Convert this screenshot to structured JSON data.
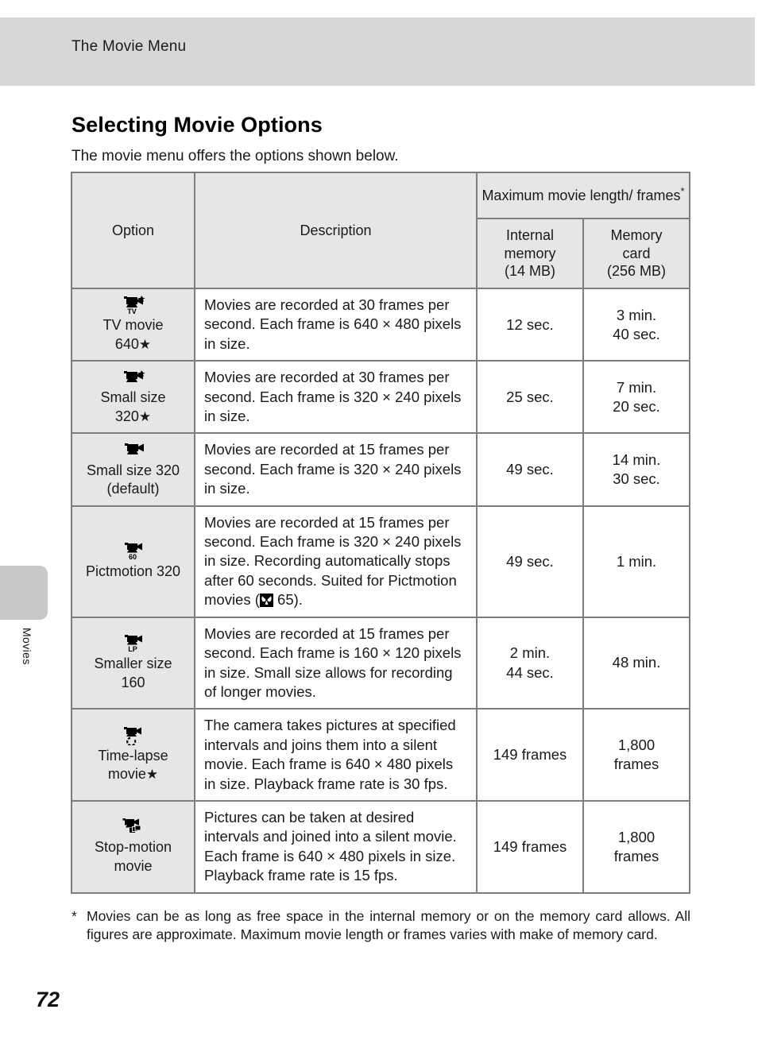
{
  "running_header": {
    "text": "The Movie Menu"
  },
  "side_tab": {
    "label": "Movies"
  },
  "page": {
    "title": "Selecting Movie Options",
    "intro": "The movie menu offers the options shown below.",
    "number": "72"
  },
  "table": {
    "headers": {
      "option": "Option",
      "description": "Description",
      "maximum_group": "Maximum movie length/ frames",
      "maximum_group_mark": "*",
      "internal": "Internal memory (14 MB)",
      "internal_line1": "Internal",
      "internal_line2": "memory",
      "internal_line3": "(14 MB)",
      "card_line1": "Memory",
      "card_line2": "card",
      "card_line3": "(256 MB)"
    },
    "rows": [
      {
        "icon": "movie-camera-tv-icon",
        "icon_badge": "TV",
        "icon_star": true,
        "option_line1": "TV movie",
        "option_line2": "640",
        "option_star": "★",
        "description": "Movies are recorded at 30 frames per second. Each frame is 640 × 480 pixels in size.",
        "internal": "12 sec.",
        "card_line1": "3 min.",
        "card_line2": "40 sec."
      },
      {
        "icon": "movie-camera-star-icon",
        "icon_badge": "",
        "icon_star": true,
        "option_line1": "Small size",
        "option_line2": "320",
        "option_star": "★",
        "description": "Movies are recorded at 30 frames per second. Each frame is 320 × 240 pixels in size.",
        "internal": "25 sec.",
        "card_line1": "7 min.",
        "card_line2": "20 sec."
      },
      {
        "icon": "movie-camera-icon",
        "icon_badge": "",
        "icon_star": false,
        "option_line1": "Small size 320",
        "option_line2": "(default)",
        "option_star": "",
        "description": "Movies are recorded at 15 frames per second. Each frame is 320 × 240 pixels in size.",
        "internal": "49 sec.",
        "card_line1": "14 min.",
        "card_line2": "30 sec."
      },
      {
        "icon": "movie-camera-60-icon",
        "icon_badge": "60",
        "icon_star": false,
        "option_line1": "Pictmotion 320",
        "option_line2": "",
        "option_star": "",
        "description_pre": "Movies are recorded at 15 frames per second. Each frame is 320 × 240 pixels in size. Recording automatically stops after 60 seconds. Suited for Pictmotion movies (",
        "description_ref_icon": "reference-butterfly-icon",
        "description_post": " 65).",
        "internal": "49 sec.",
        "card_line1": "1 min.",
        "card_line2": ""
      },
      {
        "icon": "movie-camera-lp-icon",
        "icon_badge": "LP",
        "icon_star": false,
        "option_line1": "Smaller size",
        "option_line2": "160",
        "option_star": "",
        "description": "Movies are recorded at 15 frames per second. Each frame is 160 × 120 pixels in size. Small size allows for recording of longer movies.",
        "internal_line1": "2 min.",
        "internal_line2": "44 sec.",
        "card_line1": "48 min.",
        "card_line2": ""
      },
      {
        "icon": "movie-camera-timelapse-icon",
        "icon_badge": "",
        "icon_star": false,
        "option_line1": "Time-lapse",
        "option_line2": "movie",
        "option_star": "★",
        "description": "The camera takes pictures at specified intervals and joins them into a silent movie. Each frame is 640 × 480 pixels in size. Playback frame rate is 30 fps.",
        "internal": "149 frames",
        "card_line1": "1,800",
        "card_line2": "frames"
      },
      {
        "icon": "movie-camera-stopmotion-icon",
        "icon_badge": "",
        "icon_star": false,
        "option_line1": "Stop-motion",
        "option_line2": "movie",
        "option_star": "",
        "description": "Pictures can be taken at desired intervals and joined into a silent movie. Each frame is 640 × 480 pixels in size. Playback frame rate is 15 fps.",
        "internal": "149 frames",
        "card_line1": "1,800",
        "card_line2": "frames"
      }
    ]
  },
  "footnote": {
    "mark": "*",
    "text": "Movies can be as long as free space in the internal memory or on the memory card allows. All figures are approximate. Maximum movie length or frames varies with make of memory card."
  },
  "colors": {
    "header_band": "#d7d7d7",
    "table_header_bg": "#e6e6e6",
    "table_border": "#7d7d7d",
    "tab_gray": "#c8c8c8"
  }
}
